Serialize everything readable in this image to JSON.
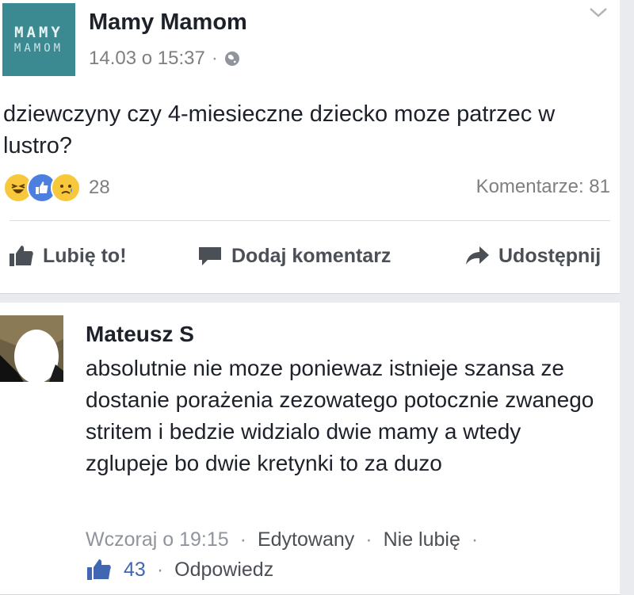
{
  "post": {
    "page_logo": {
      "line1": "MAMY",
      "line2": "MAMOM"
    },
    "page_name": "Mamy Mamom",
    "timestamp": "14.03 o 15:37",
    "separator": "·",
    "text": "dziewczyny czy 4-miesieczne dziecko moze patrzec w lustro?",
    "reaction_count": "28",
    "comments_count": "Komentarze: 81",
    "actions": {
      "like": "Lubię to!",
      "comment": "Dodaj komentarz",
      "share": "Udostępnij"
    }
  },
  "comment": {
    "author": "Mateusz S",
    "text": "absolutnie nie moze poniewaz istnieje szansa ze dostanie porażenia zezowatego potocznie zwanego stritem i bedzie widzialo dwie mamy a wtedy zglupeje bo dwie kretynki to za duzo",
    "time": "Wczoraj o 19:15",
    "edited": "Edytowany",
    "unlike": "Nie lubię",
    "like_count": "43",
    "reply": "Odpowiedz",
    "sep": "·"
  },
  "colors": {
    "accent": "#4267b2",
    "logo_bg": "#3b8a91",
    "muted": "#90949c"
  },
  "icons": [
    "chevron-down-icon",
    "globe-icon",
    "haha-icon",
    "like-icon",
    "sad-icon",
    "thumb-up-icon",
    "comment-icon",
    "share-icon"
  ]
}
